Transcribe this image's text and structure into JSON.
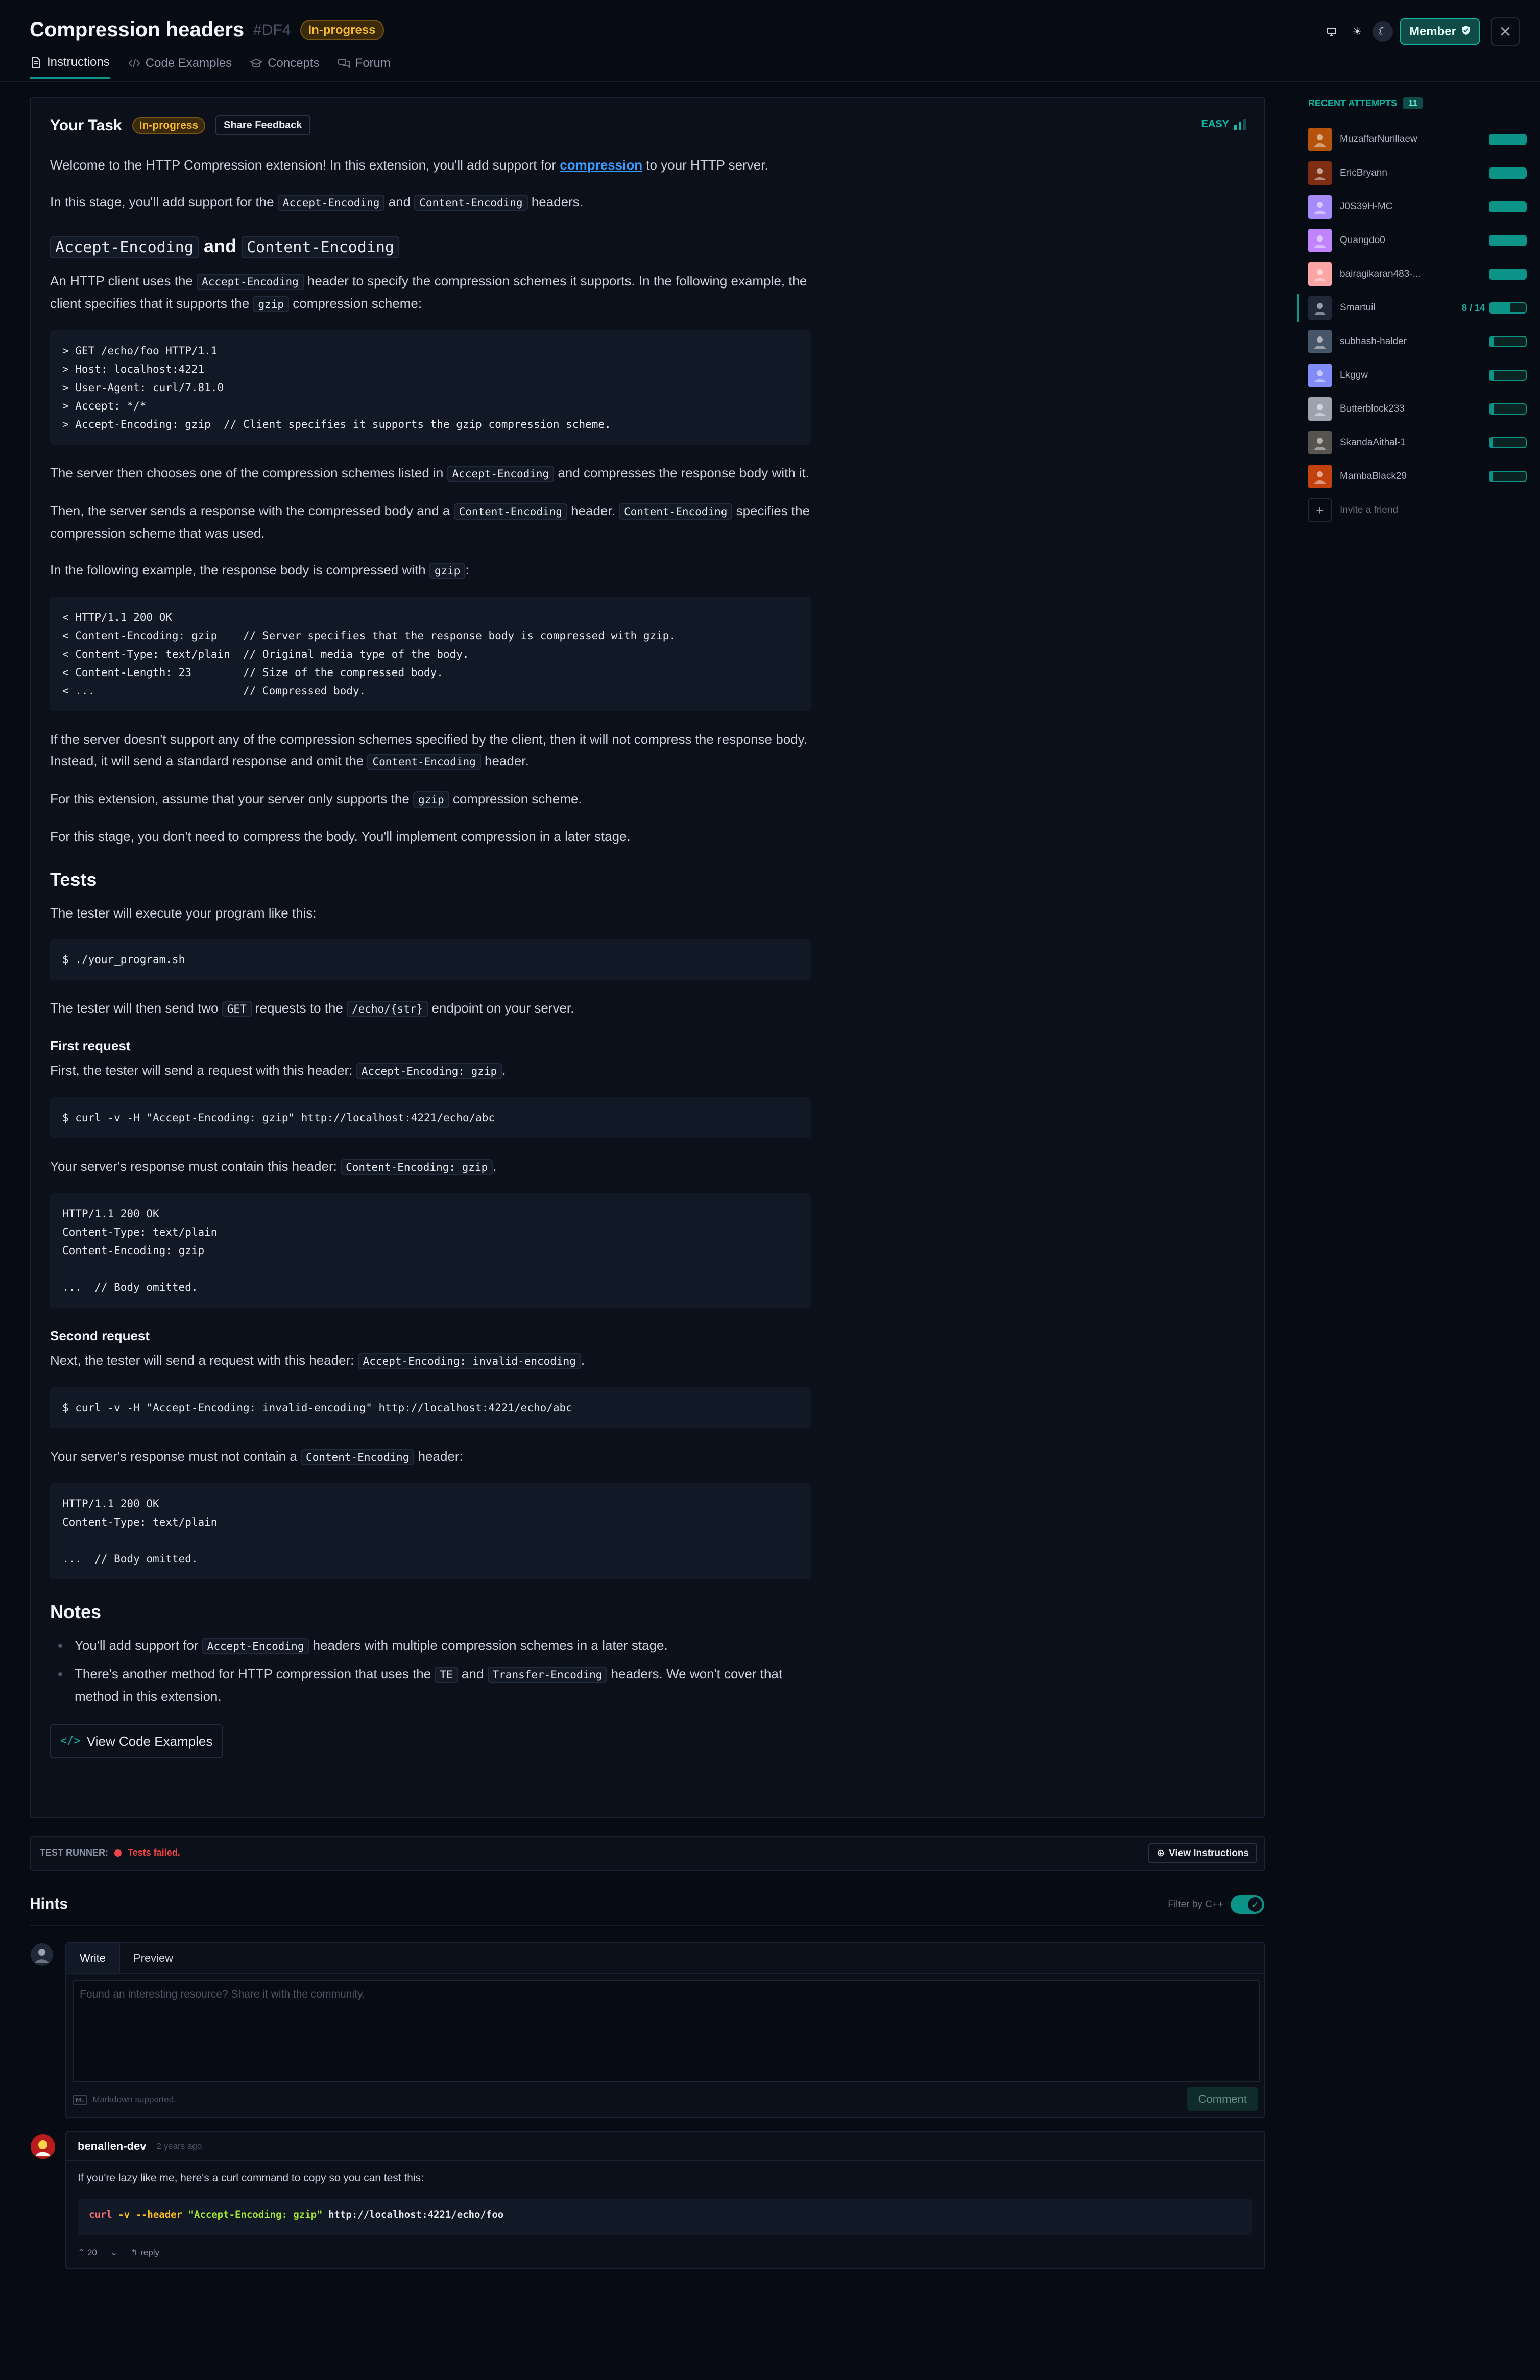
{
  "header": {
    "title": "Compression headers",
    "stage_code": "#DF4",
    "status": "In-progress",
    "member_label": "Member",
    "tabs": [
      {
        "label": "Instructions",
        "icon": "document-icon"
      },
      {
        "label": "Code Examples",
        "icon": "code-icon"
      },
      {
        "label": "Concepts",
        "icon": "graduation-cap-icon"
      },
      {
        "label": "Forum",
        "icon": "chat-bubbles-icon"
      }
    ]
  },
  "task": {
    "heading": "Your Task",
    "status": "In-progress",
    "share_feedback": "Share Feedback",
    "difficulty": "EASY",
    "intro_1a": "Welcome to the HTTP Compression extension! In this extension, you'll add support for ",
    "intro_1_link": "compression",
    "intro_1b": " to your HTTP server.",
    "intro_2a": "In this stage, you'll add support for the ",
    "intro_2b": " and ",
    "intro_2c": " headers.",
    "h_and": "and",
    "p_client_a": "An HTTP client uses the ",
    "p_client_b": " header to specify the compression schemes it supports. In the following example, the client specifies that it supports the ",
    "p_client_c": " compression scheme:",
    "code_request": "> GET /echo/foo HTTP/1.1\n> Host: localhost:4221\n> User-Agent: curl/7.81.0\n> Accept: */*\n> Accept-Encoding: gzip  // Client specifies it supports the gzip compression scheme.",
    "p_server_a": "The server then chooses one of the compression schemes listed in ",
    "p_server_b": " and compresses the response body with it.",
    "p_then_a": "Then, the server sends a response with the compressed body and a ",
    "p_then_b": " header. ",
    "p_then_c": " specifies the compression scheme that was used.",
    "p_example_a": "In the following example, the response body is compressed with ",
    "p_example_b": ":",
    "code_response": "< HTTP/1.1 200 OK\n< Content-Encoding: gzip    // Server specifies that the response body is compressed with gzip.\n< Content-Type: text/plain  // Original media type of the body.\n< Content-Length: 23        // Size of the compressed body.\n< ...                       // Compressed body.",
    "p_nosupport_a": "If the server doesn't support any of the compression schemes specified by the client, then it will not compress the response body. Instead, it will send a standard response and omit the ",
    "p_nosupport_b": " header.",
    "p_assume_a": "For this extension, assume that your server only supports the ",
    "p_assume_b": " compression scheme.",
    "p_later": "For this stage, you don't need to compress the body. You'll implement compression in a later stage.",
    "tests_heading": "Tests",
    "p_tester": "The tester will execute your program like this:",
    "code_program": "$ ./your_program.sh",
    "p_two_a": "The tester will then send two ",
    "p_two_b": " requests to the ",
    "p_two_c": " endpoint on your server.",
    "first_heading": "First request",
    "p_first_a": "First, the tester will send a request with this header: ",
    "p_first_b": ".",
    "code_first": "$ curl -v -H \"Accept-Encoding: gzip\" http://localhost:4221/echo/abc",
    "p_first_resp_a": "Your server's response must contain this header: ",
    "p_first_resp_b": ".",
    "code_first_resp": "HTTP/1.1 200 OK\nContent-Type: text/plain\nContent-Encoding: gzip\n\n...  // Body omitted.",
    "second_heading": "Second request",
    "p_second_a": "Next, the tester will send a request with this header: ",
    "p_second_b": ".",
    "code_second": "$ curl -v -H \"Accept-Encoding: invalid-encoding\" http://localhost:4221/echo/abc",
    "p_second_resp_a": "Your server's response must not contain a ",
    "p_second_resp_b": " header:",
    "code_second_resp": "HTTP/1.1 200 OK\nContent-Type: text/plain\n\n...  // Body omitted.",
    "notes_heading": "Notes",
    "note_1a": "You'll add support for ",
    "note_1b": " headers with multiple compression schemes in a later stage.",
    "note_2a": "There's another method for HTTP compression that uses the ",
    "note_2b": " and ",
    "note_2c": " headers. We won't cover that method in this extension.",
    "view_code_examples": "View Code Examples",
    "codes": {
      "accept_encoding": "Accept-Encoding",
      "content_encoding": "Content-Encoding",
      "gzip": "gzip",
      "get": "GET",
      "echo_str": "/echo/{str}",
      "ae_gzip": "Accept-Encoding: gzip",
      "ce_gzip": "Content-Encoding: gzip",
      "ae_invalid": "Accept-Encoding: invalid-encoding",
      "te": "TE",
      "transfer_encoding": "Transfer-Encoding"
    }
  },
  "runner": {
    "label": "TEST RUNNER:",
    "status": "Tests failed.",
    "view_instructions": "View Instructions"
  },
  "hints": {
    "title": "Hints",
    "filter_label": "Filter by C++",
    "tab_write": "Write",
    "tab_preview": "Preview",
    "placeholder": "Found an interesting resource? Share it with the community.",
    "markdown_note": "Markdown supported.",
    "md_icon": "M↓",
    "comment_button": "Comment"
  },
  "comment": {
    "author": "benallen-dev",
    "time": "2 years ago",
    "text": "If you're lazy like me, here's a curl command to copy so you can test this:",
    "code_cmd": "curl",
    "code_flags": "-v --header",
    "code_str": "\"Accept-Encoding: gzip\"",
    "code_url": "http://localhost:4221/echo/foo",
    "votes": "20",
    "reply": "reply"
  },
  "sidebar": {
    "title": "RECENT ATTEMPTS",
    "count": "11",
    "invite": "Invite a friend",
    "attempts": [
      {
        "name": "MuzaffarNurillaew",
        "progress": 1.0,
        "color": "#b45309"
      },
      {
        "name": "EricBryann",
        "progress": 1.0,
        "color": "#7c2d12"
      },
      {
        "name": "J0S39H-MC",
        "progress": 1.0,
        "color": "#a78bfa"
      },
      {
        "name": "Quangdo0",
        "progress": 1.0,
        "color": "#c084fc"
      },
      {
        "name": "bairagikaran483-...",
        "progress": 1.0,
        "color": "#fca5a5"
      },
      {
        "name": "Smartuil",
        "progress": 0.57,
        "steps": "8 / 14",
        "color": "#1f2937"
      },
      {
        "name": "subhash-halder",
        "progress": 0.12,
        "color": "#475569"
      },
      {
        "name": "Lkggw",
        "progress": 0.12,
        "color": "#818cf8"
      },
      {
        "name": "Butterblock233",
        "progress": 0.12,
        "color": "#9ca3af"
      },
      {
        "name": "SkandaAithal-1",
        "progress": 0.08,
        "color": "#57534e"
      },
      {
        "name": "MambaBlack29",
        "progress": 0.08,
        "color": "#c2410c"
      }
    ]
  }
}
